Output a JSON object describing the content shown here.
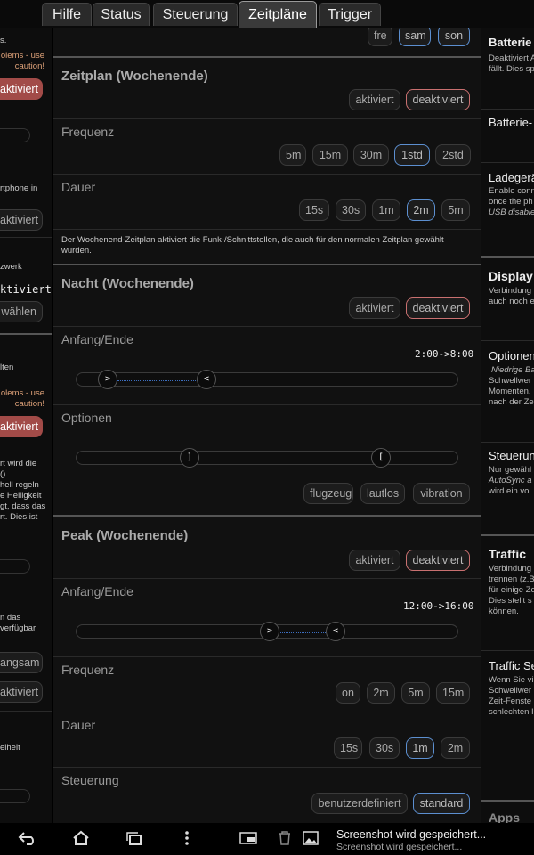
{
  "tabs": [
    "Hilfe",
    "Status",
    "Steuerung",
    "Zeitpläne",
    "Trigger"
  ],
  "active_tab": "Zeitpläne",
  "main": {
    "top_days": [
      "fre",
      "sam",
      "son"
    ],
    "schedule_weekend": {
      "title": "Zeitplan (Wochenende)",
      "toggle": [
        "aktiviert",
        "deaktiviert"
      ],
      "frequency_label": "Frequenz",
      "frequency_options": [
        "5m",
        "15m",
        "30m",
        "1std",
        "2std"
      ],
      "duration_label": "Dauer",
      "duration_options": [
        "15s",
        "30s",
        "1m",
        "2m",
        "5m"
      ],
      "description": "Der Wochenend-Zeitplan aktiviert die Funk-/Schnittstellen, die auch für den normalen Zeitplan gewählt wurden."
    },
    "night_weekend": {
      "title": "Nacht (Wochenende)",
      "toggle": [
        "aktiviert",
        "deaktiviert"
      ],
      "range_label": "Anfang/Ende",
      "range_value": "2:00->8:00",
      "handle_start": ">",
      "handle_end": "<",
      "options_label": "Optionen",
      "options_handle_a": "]",
      "options_handle_b": "[",
      "options": [
        "flugzeug",
        "lautlos",
        "vibration"
      ]
    },
    "peak_weekend": {
      "title": "Peak (Wochenende)",
      "toggle": [
        "aktiviert",
        "deaktiviert"
      ],
      "range_label": "Anfang/Ende",
      "range_value": "12:00->16:00",
      "handle_start": ">",
      "handle_end": "<",
      "frequency_label": "Frequenz",
      "frequency_options": [
        "on",
        "2m",
        "5m",
        "15m"
      ],
      "duration_label": "Dauer",
      "duration_options": [
        "15s",
        "30s",
        "1m",
        "2m"
      ],
      "control_label": "Steuerung",
      "control_options": [
        "benutzerdefiniert",
        "standard"
      ]
    }
  },
  "left": {
    "t1": "s.",
    "warn1a": "olems - use",
    "warn1b": "caution!",
    "btn1": "aktiviert",
    "t2": "rtphone in",
    "btn2": "aktiviert",
    "t3": "zwerk",
    "t4": "ktiviert",
    "btn3": "wählen",
    "t5": "lten",
    "warn2a": "olems - use",
    "warn2b": "caution!",
    "btn4": "aktiviert",
    "p1": "rt wird die",
    "p2": "()",
    "p3": "hell regeln",
    "p4": "e Helligkeit",
    "p5": "gt, dass das",
    "p6": "rt. Dies ist",
    "t6a": "n das",
    "t6b": "verfügbar",
    "btn5": "angsam",
    "btn6": "aktiviert",
    "t7": "elheit"
  },
  "right": {
    "h1": "Batterie",
    "d1a": "Deaktiviert A",
    "d1b": "fällt. Dies sp",
    "h2": "Batterie-",
    "h3": "Ladegerä",
    "d3a": "Enable conn",
    "d3b": "once the ph",
    "d3c": "USB disable",
    "h4": "Display",
    "d4a": "Verbindung",
    "d4b": "auch noch e",
    "h5": "Optionen",
    "d5a": "Niedrige Ba",
    "d5b": "Schwellwer",
    "d5c": "Momenten.",
    "d5d": "nach der Ze",
    "h6": "Steuerun",
    "d6a": "Nur gewähl",
    "d6b": "AutoSync a",
    "d6c": "wird ein vol",
    "h7": "Traffic",
    "d7a": "Verbindung",
    "d7b": "trennen (z.B",
    "d7c": "für einige Ze",
    "d7d": "Dies stellt s",
    "d7e": "können.",
    "h8": "Traffic Se",
    "d8a": "Wenn Sie vi",
    "d8b": "Schwellwer",
    "d8c": "Zeit-Fenste",
    "d8d": "schlechten I",
    "h9": "Apps"
  },
  "notification": {
    "title": "Screenshot wird gespeichert...",
    "subtitle": "Screenshot wird gespeichert..."
  },
  "icons": {
    "back": "back-icon",
    "home": "home-icon",
    "recents": "recent-apps-icon",
    "menu": "menu-icon",
    "screen": "screen-icon",
    "trash": "trash-icon",
    "image": "image-icon"
  }
}
